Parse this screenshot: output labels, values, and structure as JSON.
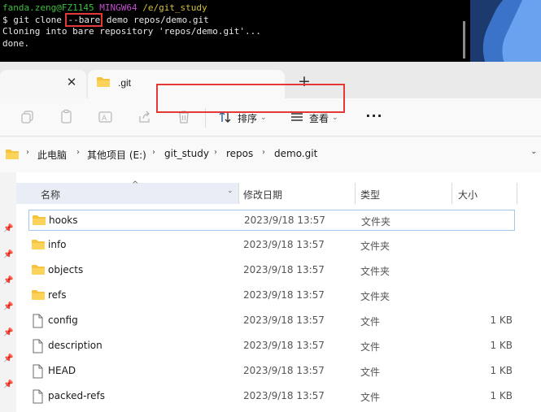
{
  "terminal": {
    "user_host": "fanda.zeng@FZ1145",
    "shell": "MINGW64",
    "cwd": "/e/git_study",
    "prompt": "$ git clone ",
    "flag": "--bare",
    "args": " demo repos/demo.git",
    "output1": "Cloning into bare repository 'repos/demo.git'...",
    "output2": "done."
  },
  "tabs": {
    "close_glyph": "✕",
    "active_title": ".git",
    "add_glyph": "+"
  },
  "toolbar": {
    "sort_label": "排序",
    "view_label": "查看",
    "more_glyph": "···",
    "chevron_glyph": "⌄",
    "icons": [
      "copy-icon",
      "paste-icon",
      "rename-icon",
      "share-icon",
      "delete-icon",
      "sort-icon",
      "view-icon"
    ]
  },
  "address": {
    "crumbs": [
      "此电脑",
      "其他项目 (E:)",
      "git_study",
      "repos",
      "demo.git"
    ],
    "sep_glyph": "›",
    "dropdown_glyph": "⌄"
  },
  "columns": {
    "name": "名称",
    "date": "修改日期",
    "type": "类型",
    "size": "大小",
    "sort_glyph": "^",
    "drop_glyph": "⌄"
  },
  "rows": [
    {
      "name": "hooks",
      "date": "2023/9/18 13:57",
      "type": "文件夹",
      "size": "",
      "kind": "folder"
    },
    {
      "name": "info",
      "date": "2023/9/18 13:57",
      "type": "文件夹",
      "size": "",
      "kind": "folder"
    },
    {
      "name": "objects",
      "date": "2023/9/18 13:57",
      "type": "文件夹",
      "size": "",
      "kind": "folder"
    },
    {
      "name": "refs",
      "date": "2023/9/18 13:57",
      "type": "文件夹",
      "size": "",
      "kind": "folder"
    },
    {
      "name": "config",
      "date": "2023/9/18 13:57",
      "type": "文件",
      "size": "1 KB",
      "kind": "file"
    },
    {
      "name": "description",
      "date": "2023/9/18 13:57",
      "type": "文件",
      "size": "1 KB",
      "kind": "file"
    },
    {
      "name": "HEAD",
      "date": "2023/9/18 13:57",
      "type": "文件",
      "size": "1 KB",
      "kind": "file"
    },
    {
      "name": "packed-refs",
      "date": "2023/9/18 13:57",
      "type": "文件",
      "size": "1 KB",
      "kind": "file"
    }
  ],
  "pin_glyph": "📌",
  "colors": {
    "highlight_red": "#e53935",
    "folder_yellow": "#f8c33c",
    "selection_border": "#9ec6ef"
  }
}
